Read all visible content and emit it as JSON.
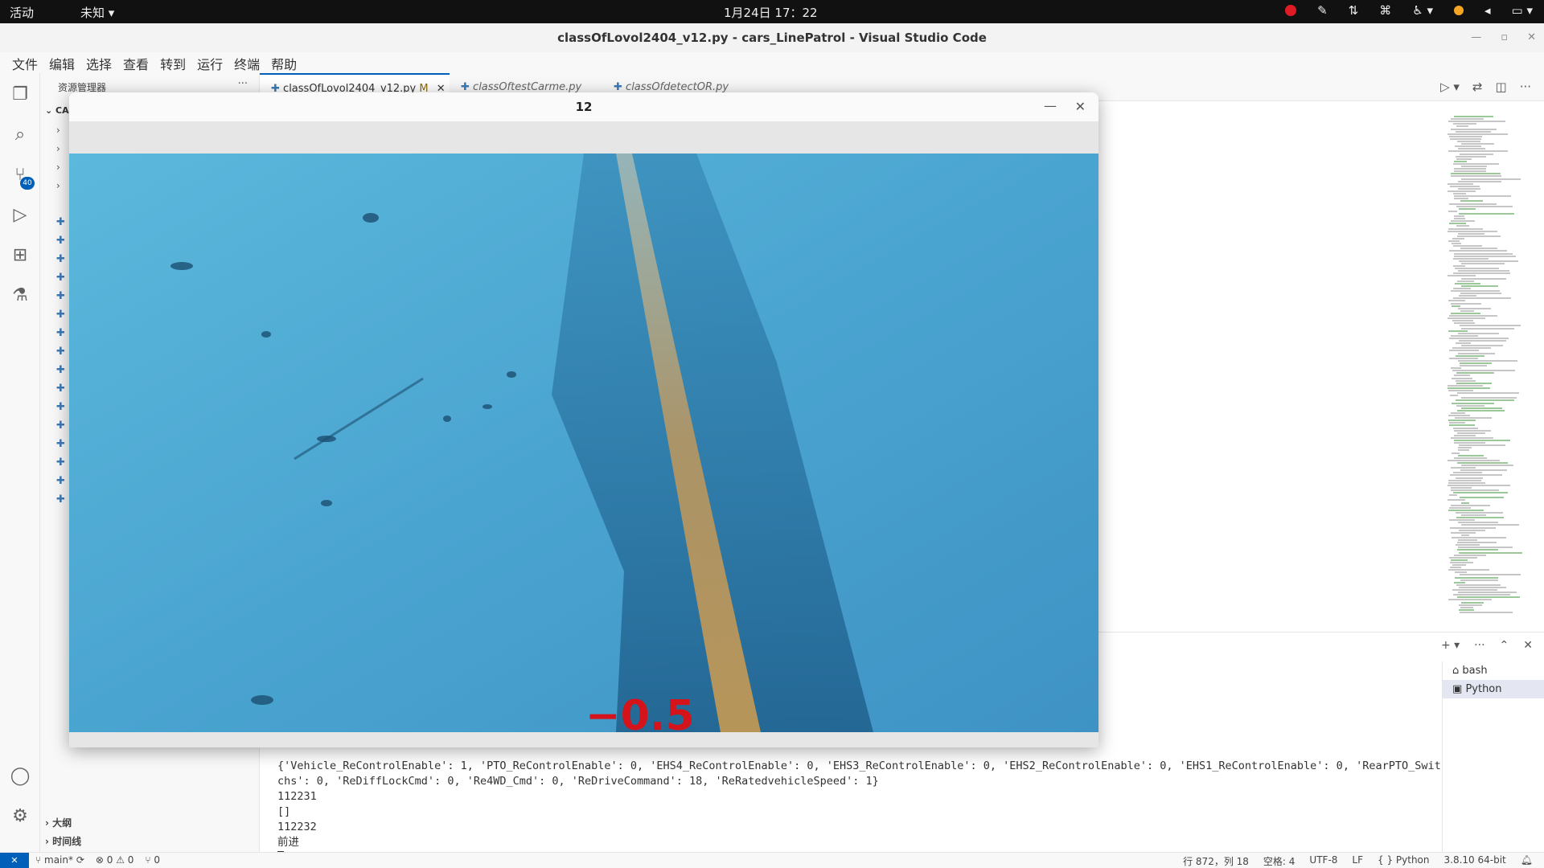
{
  "topbar": {
    "activities": "活动",
    "app_menu": "未知 ▾",
    "clock": "1月24日  17：22"
  },
  "window": {
    "title": "classOfLovol2404_v12.py - cars_LinePatrol - Visual Studio Code"
  },
  "menu": [
    "文件",
    "编辑",
    "选择",
    "查看",
    "转到",
    "运行",
    "终端",
    "帮助"
  ],
  "activity_bar": {
    "scm_badge": "40"
  },
  "sidebar": {
    "header": "资源管理器",
    "project": "CA",
    "sections": {
      "outline": "大纲",
      "timeline": "时间线"
    }
  },
  "tabs": [
    {
      "label": "classOfLovol2404_v12.py",
      "modified": "M"
    },
    {
      "label": "classOftestCarme.py"
    },
    {
      "label": "classOfdetectOR.py"
    }
  ],
  "camera_window": {
    "title": "12",
    "steer_value": "−0.5"
  },
  "terminal": {
    "lines": [
      "{'Vehicle_ReControlEnable': 1, 'PTO_ReControlEnable': 0, 'EHS4_ReControlEnable': 0, 'EHS3_ReControlEnable': 0, 'EHS2_ReControlEnable': 0, 'EHS1_ReControlEnable': 0, 'RearPTO_Swit",
      "chs': 0, 'ReDiffLockCmd': 0, 'Re4WD_Cmd': 0, 'ReDriveCommand': 18, 'ReRatedvehicleSpeed': 1}",
      "112231",
      "[]",
      "112232",
      "前进"
    ],
    "sessions": [
      "bash",
      "Python"
    ]
  },
  "statusbar": {
    "branch": "main*",
    "problems": "⊗ 0 ⚠ 0",
    "ports": "⑂ 0",
    "position": "行 872，列 18",
    "spaces": "空格: 4",
    "encoding": "UTF-8",
    "eol": "LF",
    "language": "Python",
    "interpreter": "3.8.10 64-bit"
  },
  "colors": {
    "accent": "#005fb8",
    "steer_text": "#d4141a",
    "camera_floor": "#4ba6d2",
    "road_line": "#c79a52"
  }
}
